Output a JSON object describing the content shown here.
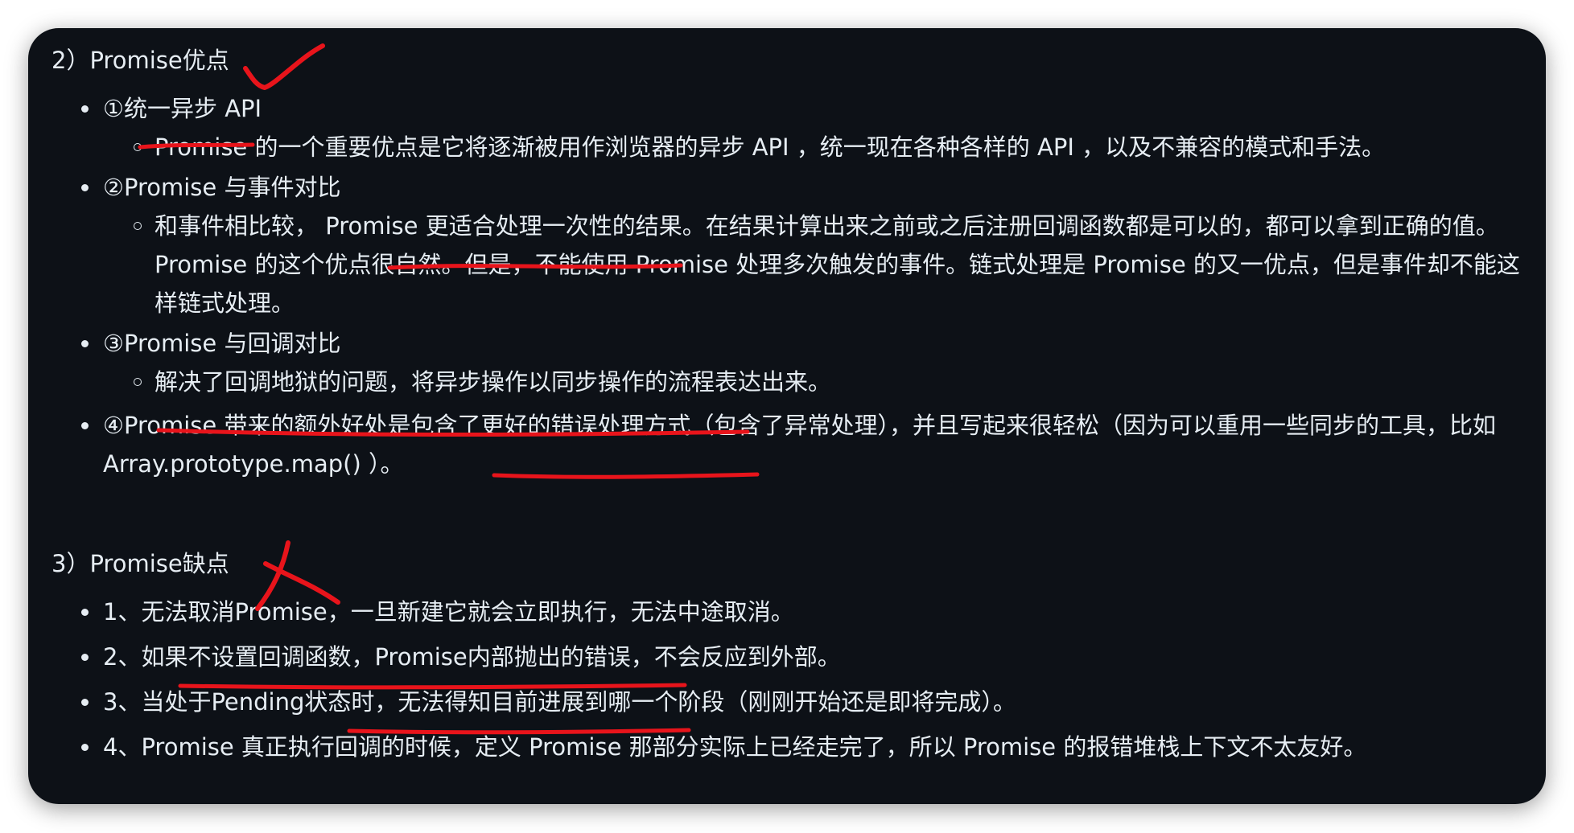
{
  "advantages": {
    "heading": "2）Promise优点",
    "items": [
      {
        "title": "①统一异步 API",
        "detail": "Promise 的一个重要优点是它将逐渐被用作浏览器的异步 API ，统一现在各种各样的 API ，以及不兼容的模式和手法。"
      },
      {
        "title": "②Promise 与事件对比",
        "detail": "和事件相比较， Promise 更适合处理一次性的结果。在结果计算出来之前或之后注册回调函数都是可以的，都可以拿到正确的值。 Promise 的这个优点很自然。但是，不能使用 Promise 处理多次触发的事件。链式处理是 Promise 的又一优点，但是事件却不能这样链式处理。"
      },
      {
        "title": "③Promise 与回调对比",
        "detail": "解决了回调地狱的问题，将异步操作以同步操作的流程表达出来。"
      },
      {
        "title": "④Promise 带来的额外好处是包含了更好的错误处理方式（包含了异常处理），并且写起来很轻松（因为可以重用一些同步的工具，比如 Array.prototype.map() ）。"
      }
    ]
  },
  "disadvantages": {
    "heading": "3）Promise缺点",
    "items": [
      "1、无法取消Promise，一旦新建它就会立即执行，无法中途取消。",
      "2、如果不设置回调函数，Promise内部抛出的错误，不会反应到外部。",
      "3、当处于Pending状态时，无法得知目前进展到哪一个阶段（刚刚开始还是即将完成）。",
      "4、Promise 真正执行回调的时候，定义 Promise 那部分实际上已经走完了，所以 Promise 的报错堆栈上下文不太友好。"
    ]
  },
  "colors": {
    "background": "#0d1117",
    "text": "#e6edf3",
    "annotation": "#e8141b"
  }
}
